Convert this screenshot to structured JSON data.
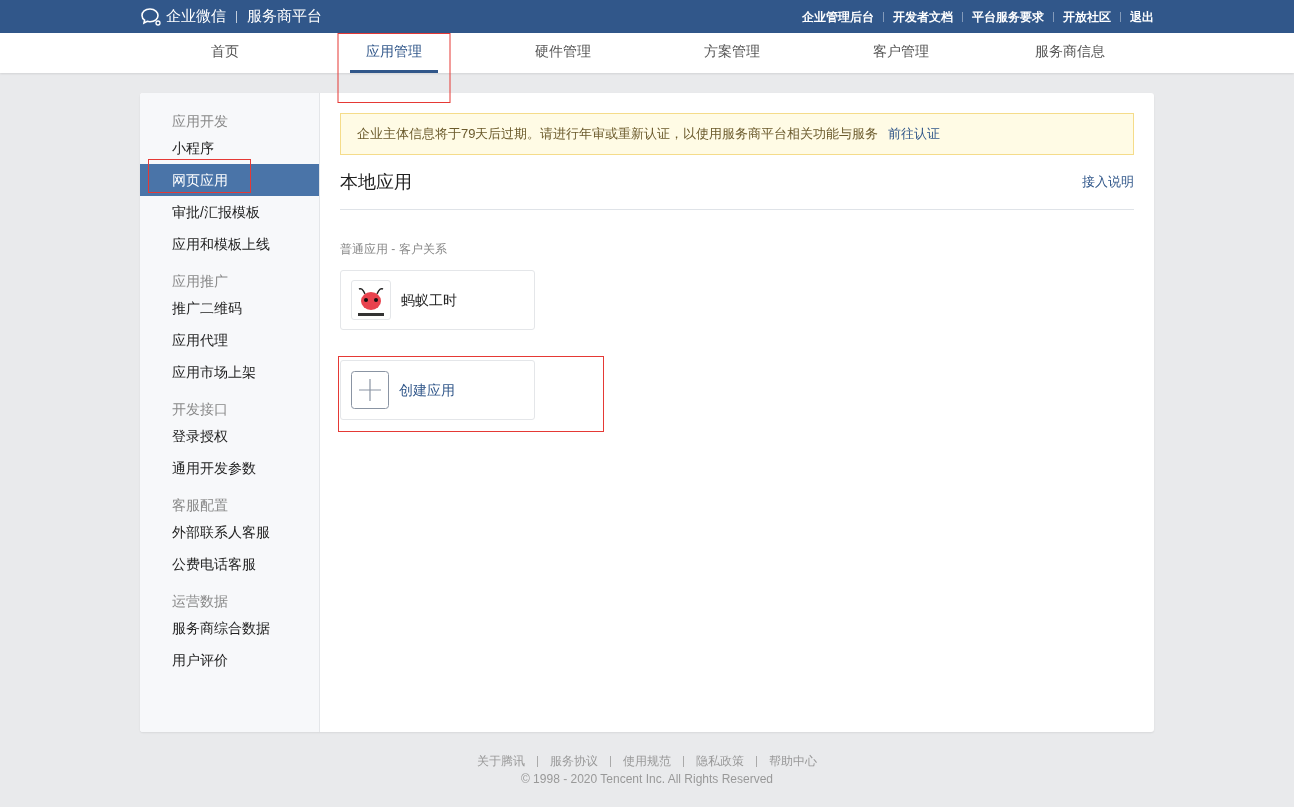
{
  "header": {
    "brand": "企业微信",
    "platform": "服务商平台",
    "links": [
      "企业管理后台",
      "开发者文档",
      "平台服务要求",
      "开放社区",
      "退出"
    ]
  },
  "nav": [
    {
      "label": "首页",
      "selected": false,
      "highlighted": false
    },
    {
      "label": "应用管理",
      "selected": true,
      "highlighted": true
    },
    {
      "label": "硬件管理",
      "selected": false,
      "highlighted": false
    },
    {
      "label": "方案管理",
      "selected": false,
      "highlighted": false
    },
    {
      "label": "客户管理",
      "selected": false,
      "highlighted": false
    },
    {
      "label": "服务商信息",
      "selected": false,
      "highlighted": false
    }
  ],
  "sidebar": [
    {
      "title": "应用开发",
      "items": [
        {
          "label": "小程序",
          "selected": false,
          "highlighted": false
        },
        {
          "label": "网页应用",
          "selected": true,
          "highlighted": true
        },
        {
          "label": "审批/汇报模板",
          "selected": false,
          "highlighted": false
        },
        {
          "label": "应用和模板上线",
          "selected": false,
          "highlighted": false
        }
      ]
    },
    {
      "title": "应用推广",
      "items": [
        {
          "label": "推广二维码",
          "selected": false,
          "highlighted": false
        },
        {
          "label": "应用代理",
          "selected": false,
          "highlighted": false
        },
        {
          "label": "应用市场上架",
          "selected": false,
          "highlighted": false
        }
      ]
    },
    {
      "title": "开发接口",
      "items": [
        {
          "label": "登录授权",
          "selected": false,
          "highlighted": false
        },
        {
          "label": "通用开发参数",
          "selected": false,
          "highlighted": false
        }
      ]
    },
    {
      "title": "客服配置",
      "items": [
        {
          "label": "外部联系人客服",
          "selected": false,
          "highlighted": false
        },
        {
          "label": "公费电话客服",
          "selected": false,
          "highlighted": false
        }
      ]
    },
    {
      "title": "运营数据",
      "items": [
        {
          "label": "服务商综合数据",
          "selected": false,
          "highlighted": false
        },
        {
          "label": "用户评价",
          "selected": false,
          "highlighted": false
        }
      ]
    }
  ],
  "notice": {
    "text": "企业主体信息将于79天后过期。请进行年审或重新认证，以使用服务商平台相关功能与服务",
    "link": "前往认证"
  },
  "section": {
    "title": "本地应用",
    "help_link": "接入说明",
    "category": "普通应用 - 客户关系"
  },
  "apps": [
    {
      "kind": "app",
      "name": "蚂蚁工时",
      "highlighted": false
    },
    {
      "kind": "create",
      "name": "创建应用",
      "highlighted": true
    }
  ],
  "footer": {
    "links": [
      "关于腾讯",
      "服务协议",
      "使用规范",
      "隐私政策",
      "帮助中心"
    ],
    "copyright": "© 1998 - 2020 Tencent Inc. All Rights Reserved"
  }
}
